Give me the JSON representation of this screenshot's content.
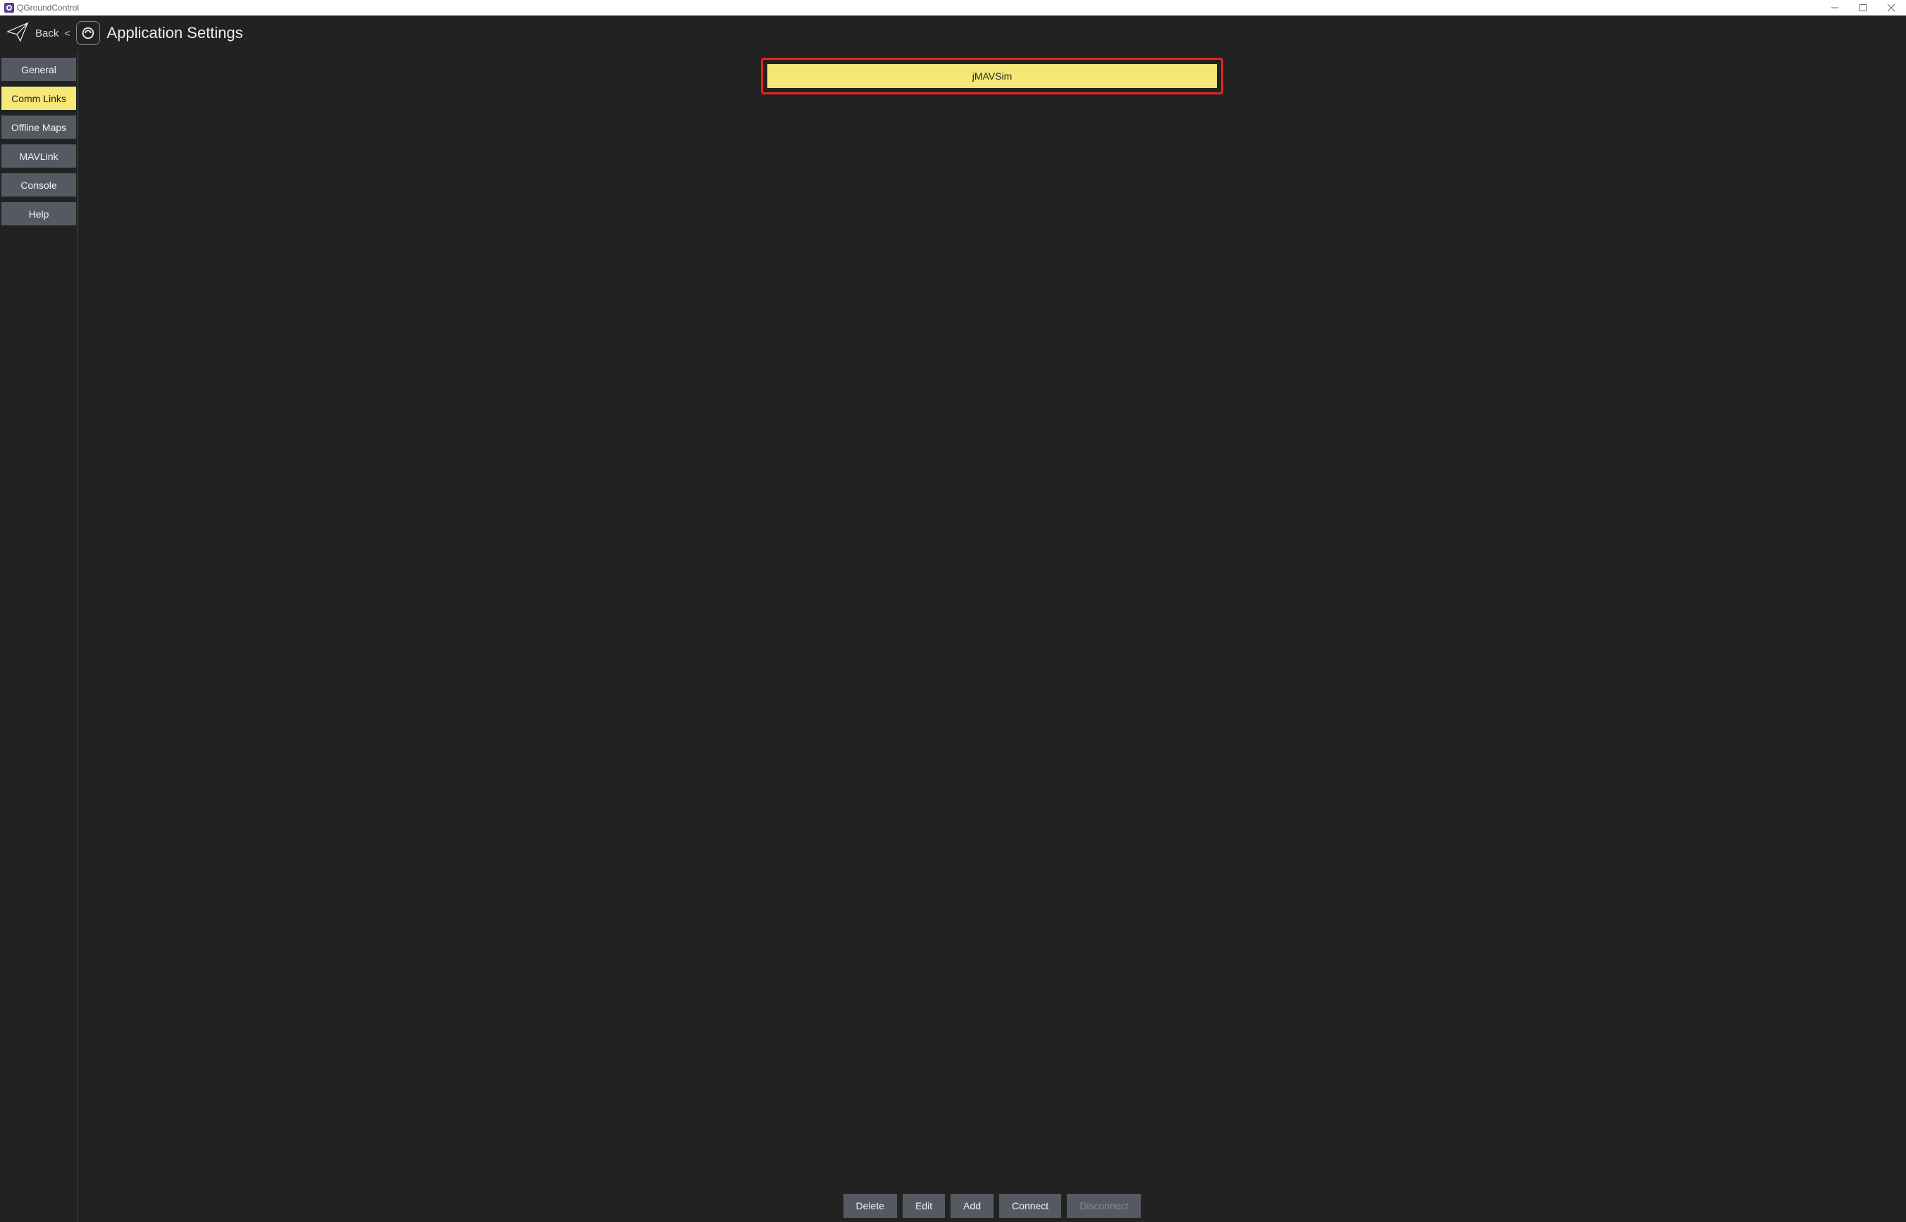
{
  "window": {
    "title": "QGroundControl"
  },
  "header": {
    "back": "Back",
    "chevron": "<",
    "title": "Application Settings"
  },
  "sidebar": {
    "items": [
      {
        "label": "General",
        "active": false
      },
      {
        "label": "Comm Links",
        "active": true
      },
      {
        "label": "Offline Maps",
        "active": false
      },
      {
        "label": "MAVLink",
        "active": false
      },
      {
        "label": "Console",
        "active": false
      },
      {
        "label": "Help",
        "active": false
      }
    ]
  },
  "comm_links": {
    "entries": [
      {
        "name": "jMAVSim",
        "selected": true
      }
    ]
  },
  "actions": {
    "delete": "Delete",
    "edit": "Edit",
    "add": "Add",
    "connect": "Connect",
    "disconnect": "Disconnect"
  },
  "colors": {
    "accent_yellow": "#f5e876",
    "highlight_red": "#e8231a",
    "button_bg": "#555a62",
    "app_bg": "#222222"
  }
}
